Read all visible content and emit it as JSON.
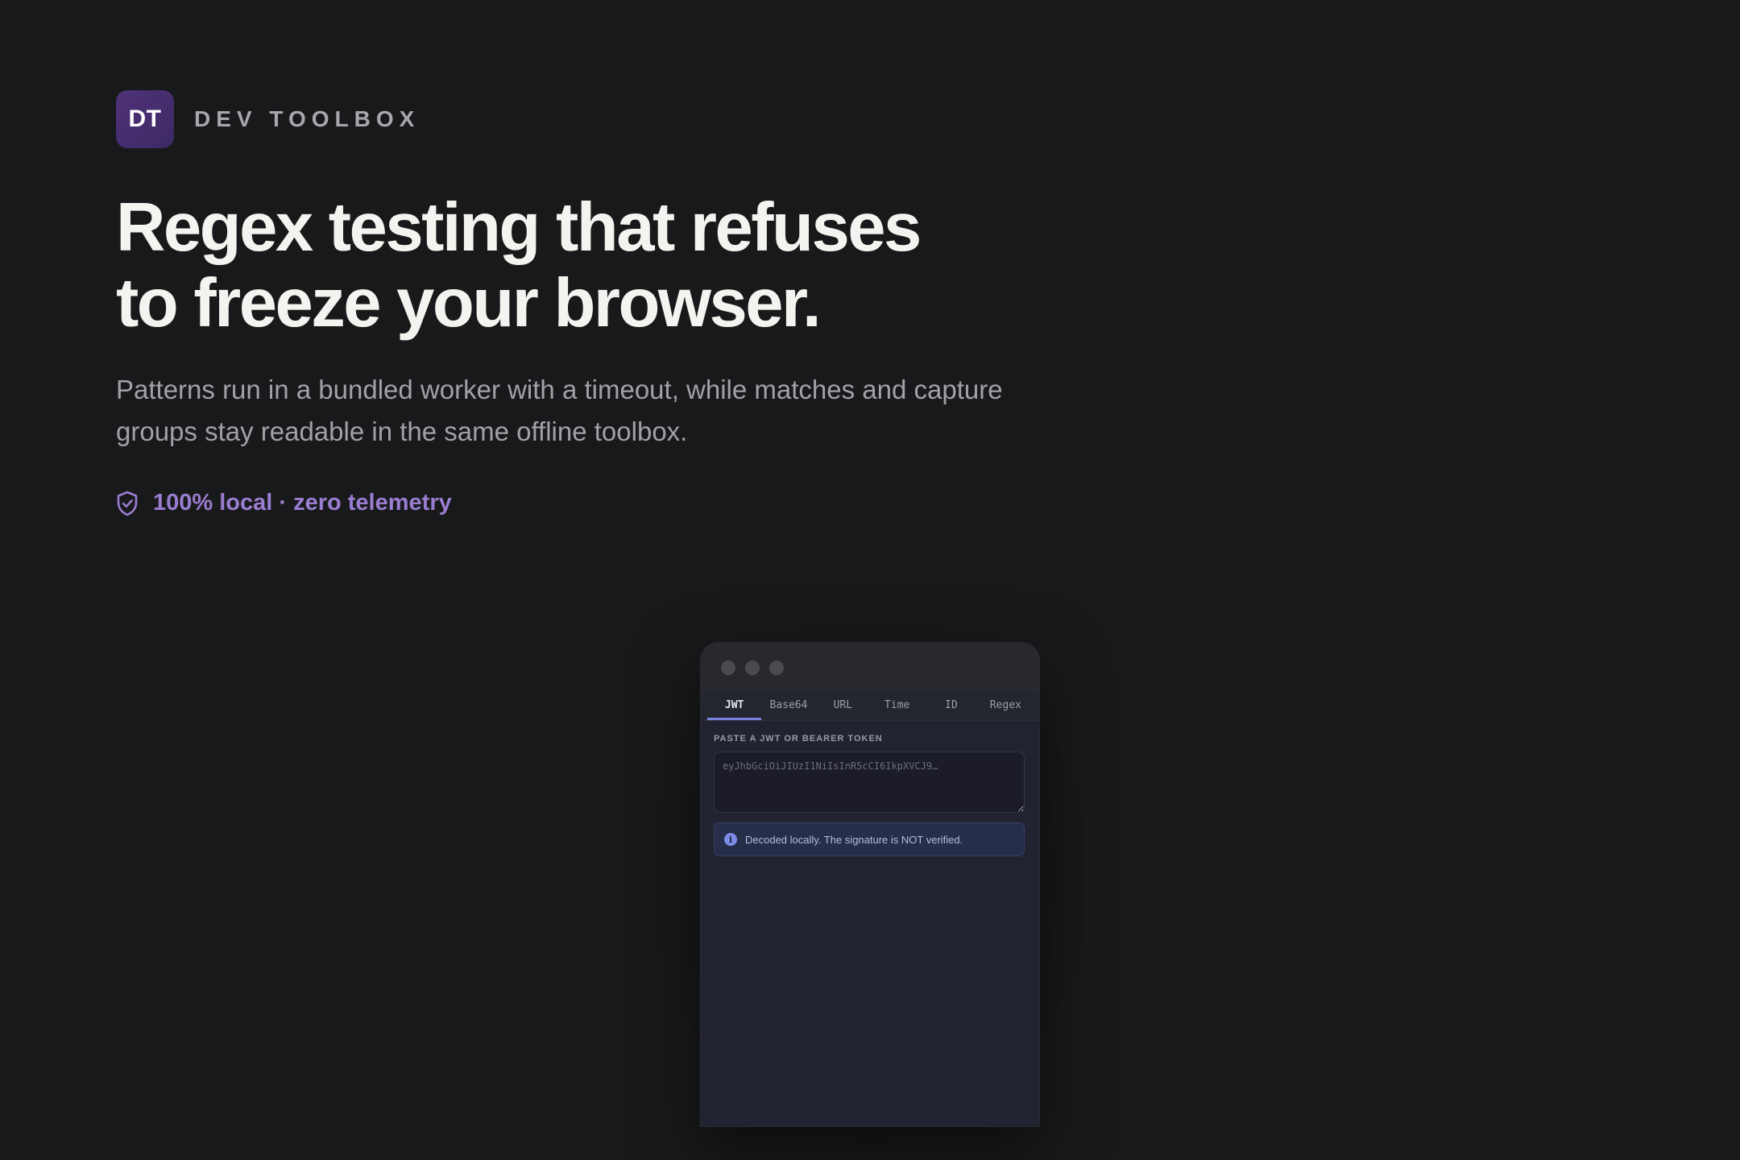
{
  "brand": {
    "logo_text": "DT",
    "name": "DEV TOOLBOX"
  },
  "hero": {
    "headline_line1": "Regex testing that refuses",
    "headline_line2": "to freeze your browser.",
    "subhead": "Patterns run in a bundled worker with a timeout, while matches and capture groups stay readable in the same offline toolbox.",
    "badge_text": "100% local · zero telemetry",
    "badge_icon": "shield-check-icon"
  },
  "app_window": {
    "tabs": [
      {
        "label": "JWT",
        "active": true
      },
      {
        "label": "Base64",
        "active": false
      },
      {
        "label": "URL",
        "active": false
      },
      {
        "label": "Time",
        "active": false
      },
      {
        "label": "ID",
        "active": false
      },
      {
        "label": "Regex",
        "active": false
      }
    ],
    "input_label": "PASTE A JWT OR BEARER TOKEN",
    "input_placeholder": "eyJhbGciOiJIUzI1NiIsInR5cCI6IkpXVCJ9…",
    "input_value": "",
    "notice_icon": "info-icon",
    "notice_text": "Decoded locally. The signature is NOT verified."
  },
  "colors": {
    "background": "#18191b",
    "accent_purple": "#9a7dd0",
    "logo_bg": "#4f3278",
    "tab_active_underline": "#7a82e0",
    "notice_bg": "#262e4a"
  }
}
